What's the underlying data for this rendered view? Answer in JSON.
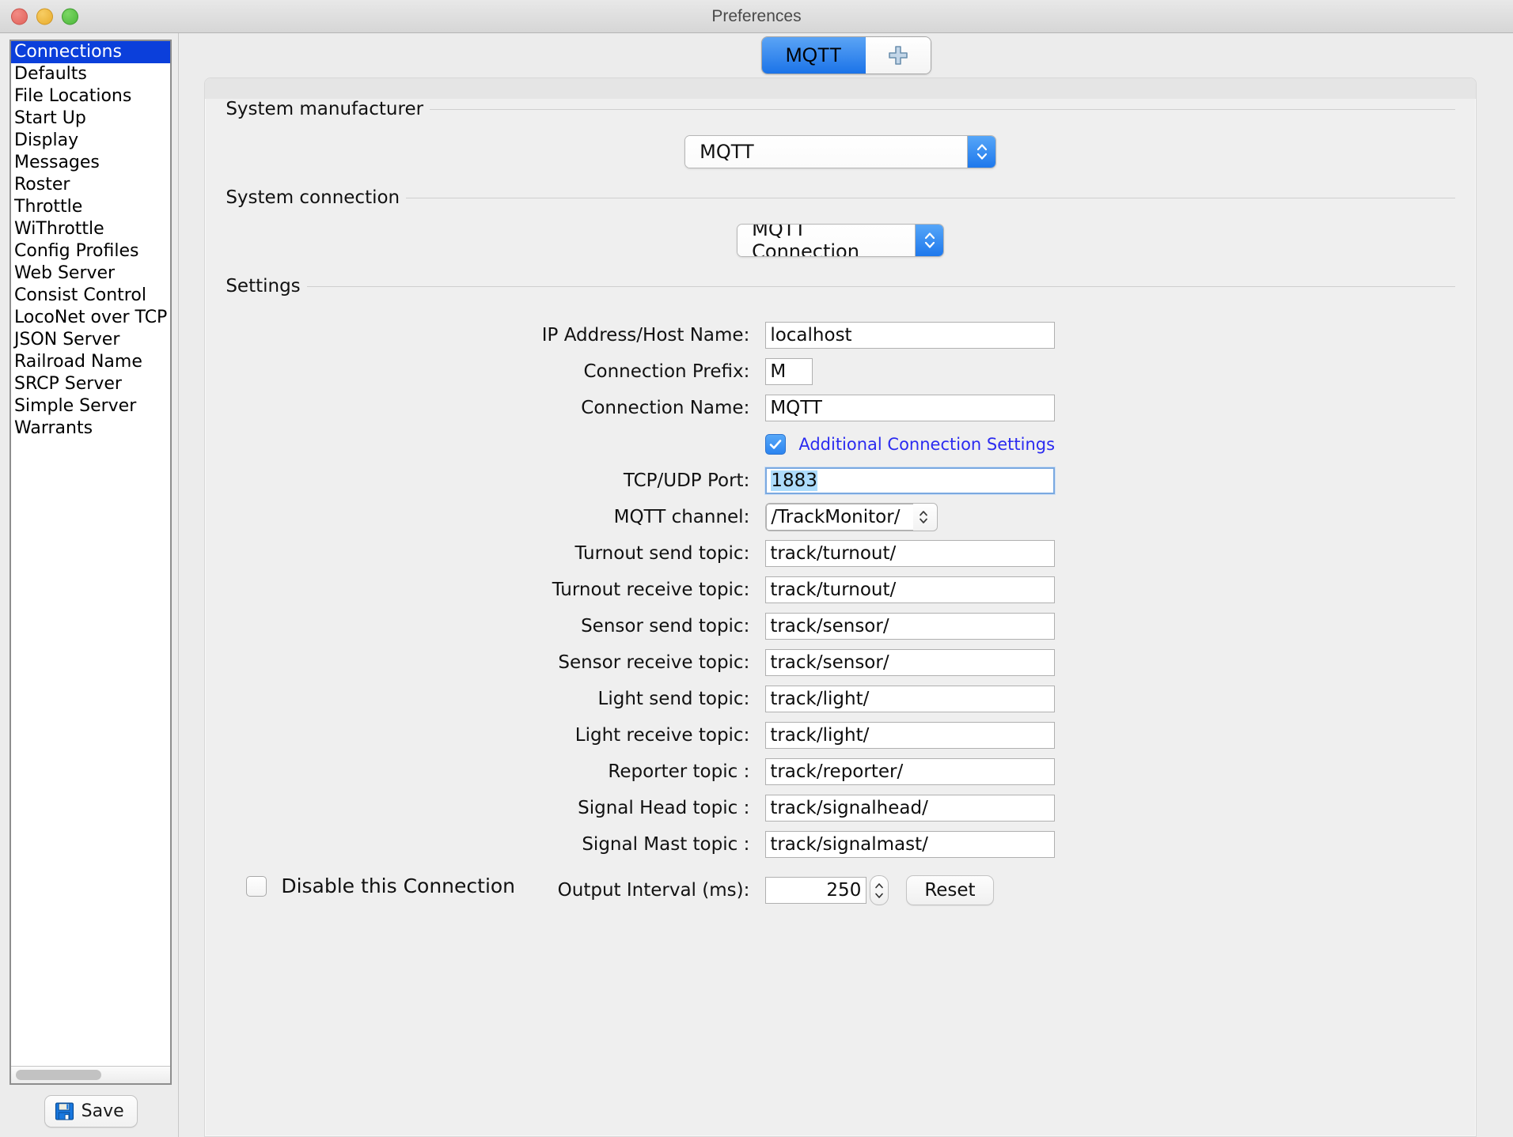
{
  "window": {
    "title": "Preferences",
    "traffic_lights": [
      "close-red",
      "minimize-yellow",
      "zoom-green"
    ]
  },
  "sidebar": {
    "items": [
      {
        "label": "Connections",
        "selected": true
      },
      {
        "label": "Defaults",
        "selected": false
      },
      {
        "label": "File Locations",
        "selected": false
      },
      {
        "label": "Start Up",
        "selected": false
      },
      {
        "label": "Display",
        "selected": false
      },
      {
        "label": "Messages",
        "selected": false
      },
      {
        "label": "Roster",
        "selected": false
      },
      {
        "label": "Throttle",
        "selected": false
      },
      {
        "label": "WiThrottle",
        "selected": false
      },
      {
        "label": "Config Profiles",
        "selected": false
      },
      {
        "label": "Web Server",
        "selected": false
      },
      {
        "label": "Consist Control",
        "selected": false
      },
      {
        "label": "LocoNet over TCP",
        "selected": false
      },
      {
        "label": "JSON Server",
        "selected": false
      },
      {
        "label": "Railroad Name",
        "selected": false
      },
      {
        "label": "SRCP Server",
        "selected": false
      },
      {
        "label": "Simple Server",
        "selected": false
      },
      {
        "label": "Warrants",
        "selected": false
      }
    ],
    "save_label": "Save",
    "save_icon": "floppy-disk-icon"
  },
  "tabs": {
    "items": [
      {
        "label": "MQTT",
        "active": true
      }
    ],
    "add_tab_icon": "plus-icon"
  },
  "groups": {
    "manufacturer_title": "System manufacturer",
    "connection_title": "System connection",
    "settings_title": "Settings"
  },
  "manufacturer": {
    "value": "MQTT",
    "arrow_icon": "chevron-up-down-icon"
  },
  "connection": {
    "value": "MQTT Connection",
    "arrow_icon": "chevron-up-down-icon"
  },
  "settings": {
    "ip_address": {
      "label": "IP Address/Host Name:",
      "value": "localhost"
    },
    "connection_prefix": {
      "label": "Connection Prefix:",
      "value": "M"
    },
    "connection_name": {
      "label": "Connection Name:",
      "value": "MQTT"
    },
    "additional_settings": {
      "label": "Additional Connection Settings",
      "checked": true
    },
    "tcp_udp_port": {
      "label": "TCP/UDP Port:",
      "value": "1883",
      "focused": true,
      "selected": true
    },
    "mqtt_channel": {
      "label": "MQTT channel:",
      "value": "/TrackMonitor/",
      "arrow_icon": "chevron-up-down-small-icon"
    },
    "turnout_send": {
      "label": "Turnout send topic:",
      "value": "track/turnout/"
    },
    "turnout_receive": {
      "label": "Turnout receive topic:",
      "value": "track/turnout/"
    },
    "sensor_send": {
      "label": "Sensor send topic:",
      "value": "track/sensor/"
    },
    "sensor_receive": {
      "label": "Sensor receive topic:",
      "value": "track/sensor/"
    },
    "light_send": {
      "label": "Light send topic:",
      "value": "track/light/"
    },
    "light_receive": {
      "label": "Light receive topic:",
      "value": "track/light/"
    },
    "reporter": {
      "label": "Reporter topic :",
      "value": "track/reporter/"
    },
    "signal_head": {
      "label": "Signal Head topic :",
      "value": "track/signalhead/"
    },
    "signal_mast": {
      "label": "Signal Mast topic :",
      "value": "track/signalmast/"
    },
    "output_interval": {
      "label": "Output Interval (ms):",
      "value": "250",
      "spinner_icon": "spinner-up-down-icon"
    },
    "reset_label": "Reset"
  },
  "footer": {
    "disable_connection": {
      "label": "Disable this Connection",
      "checked": false
    }
  },
  "colors": {
    "accent_blue": "#1b73e8",
    "selection_blue": "#0b3fdb",
    "link_blue": "#2b2bf0",
    "text_selection": "#addcfc",
    "window_bg": "#ececec",
    "panel_bg": "#efefef"
  }
}
